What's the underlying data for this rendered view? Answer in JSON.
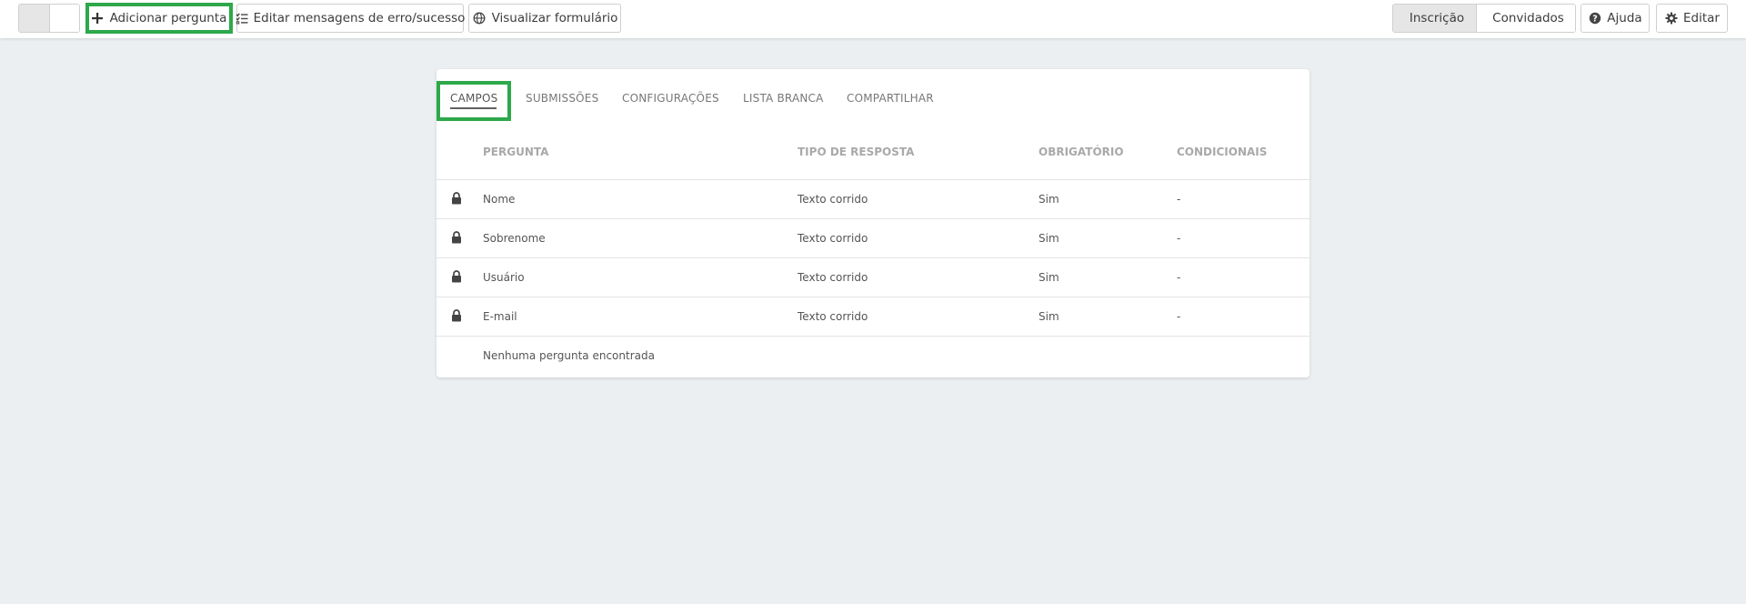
{
  "toolbar": {
    "add_question": "Adicionar pergunta",
    "edit_messages": "Editar mensagens de erro/sucesso",
    "view_form": "Visualizar formulário",
    "inscricao": "Inscrição",
    "convidados": "Convidados",
    "ajuda": "Ajuda",
    "editar": "Editar",
    "icons": [
      "menu-icon",
      "pie-chart-icon",
      "plus-icon",
      "checklist-icon",
      "globe-icon",
      "user-icon",
      "users-icon",
      "help-circle-icon",
      "gear-icon"
    ]
  },
  "tabs": [
    {
      "label": "CAMPOS",
      "active": true
    },
    {
      "label": "SUBMISSÕES",
      "active": false
    },
    {
      "label": "CONFIGURAÇÕES",
      "active": false
    },
    {
      "label": "LISTA BRANCA",
      "active": false
    },
    {
      "label": "COMPARTILHAR",
      "active": false
    }
  ],
  "table": {
    "headers": [
      "PERGUNTA",
      "TIPO DE RESPOSTA",
      "OBRIGATÓRIO",
      "CONDICIONAIS"
    ],
    "rows": [
      {
        "pergunta": "Nome",
        "tipo": "Texto corrido",
        "obrigatorio": "Sim",
        "condicionais": "-",
        "icon": "lock-icon"
      },
      {
        "pergunta": "Sobrenome",
        "tipo": "Texto corrido",
        "obrigatorio": "Sim",
        "condicionais": "-",
        "icon": "lock-icon"
      },
      {
        "pergunta": "Usuário",
        "tipo": "Texto corrido",
        "obrigatorio": "Sim",
        "condicionais": "-",
        "icon": "lock-icon"
      },
      {
        "pergunta": "E-mail",
        "tipo": "Texto corrido",
        "obrigatorio": "Sim",
        "condicionais": "-",
        "icon": "lock-icon"
      }
    ],
    "empty_message": "Nenhuma pergunta encontrada"
  },
  "colors": {
    "highlight": "#2da84a",
    "background": "#eceff1"
  }
}
